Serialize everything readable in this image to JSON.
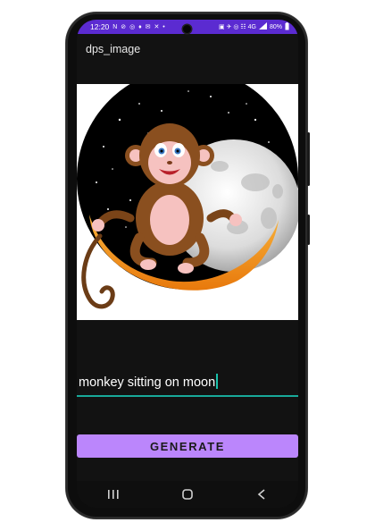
{
  "status": {
    "time": "12:20",
    "left_icons": "N ⊘ ◎ ♦ ✉ ✕ •",
    "right_icons": "▣ ✈ ◎ ☷ 4G",
    "battery": "80%"
  },
  "app": {
    "title": "dps_image"
  },
  "prompt": {
    "value": "monkey sitting on moon"
  },
  "button": {
    "generate_label": "GENERATE"
  },
  "navbar": {
    "recents_icon": "|||",
    "home_icon": "○",
    "back_icon": "<"
  }
}
